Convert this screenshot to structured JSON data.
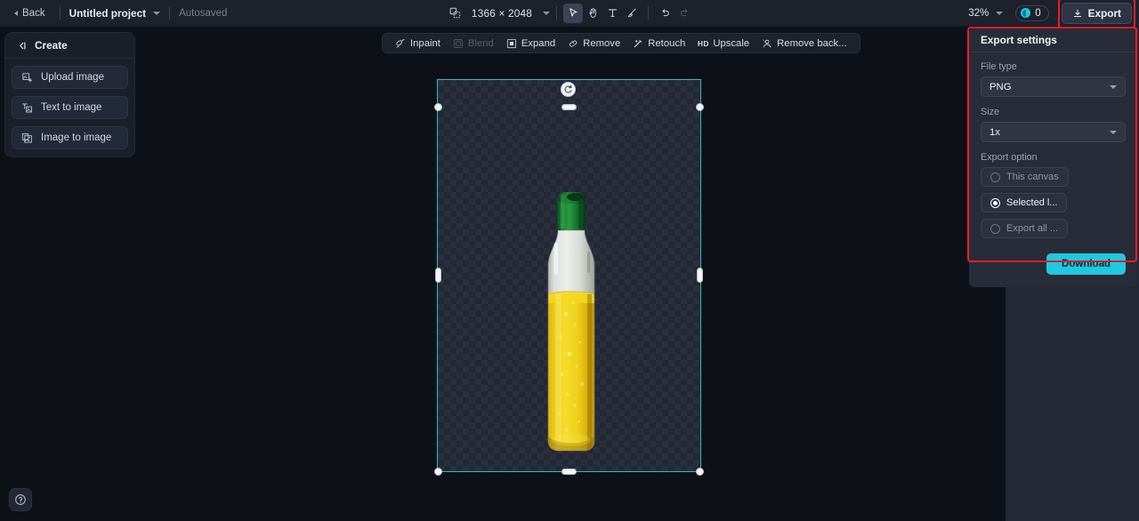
{
  "topbar": {
    "back_label": "Back",
    "project_name": "Untitled project",
    "autosaved_label": "Autosaved",
    "canvas_size_label": "1366 × 2048",
    "zoom_label": "32%",
    "credits_count": "0",
    "export_label": "Export",
    "tools": [
      {
        "name": "resize-canvas-icon",
        "label": "Resize canvas",
        "active": false
      },
      {
        "name": "select-tool-icon",
        "label": "Select",
        "active": true
      },
      {
        "name": "hand-tool-icon",
        "label": "Hand",
        "active": false
      },
      {
        "name": "text-tool-icon",
        "label": "Text",
        "active": false
      },
      {
        "name": "brush-tool-icon",
        "label": "Brush",
        "active": false
      },
      {
        "name": "undo-icon",
        "label": "Undo",
        "active": false
      },
      {
        "name": "redo-icon",
        "label": "Redo",
        "active": false
      }
    ]
  },
  "sidebar": {
    "header_label": "Create",
    "items": [
      {
        "label": "Upload image",
        "icon": "upload-image-icon"
      },
      {
        "label": "Text to image",
        "icon": "text-to-image-icon"
      },
      {
        "label": "Image to image",
        "icon": "image-to-image-icon"
      }
    ]
  },
  "canvas_tools": [
    {
      "label": "Inpaint",
      "icon": "inpaint-icon",
      "disabled": false
    },
    {
      "label": "Blend",
      "icon": "blend-icon",
      "disabled": true
    },
    {
      "label": "Expand",
      "icon": "expand-icon",
      "disabled": false
    },
    {
      "label": "Remove",
      "icon": "remove-icon",
      "disabled": false
    },
    {
      "label": "Retouch",
      "icon": "retouch-icon",
      "disabled": false
    },
    {
      "label": "Upscale",
      "icon": "upscale-hd-icon",
      "disabled": false
    },
    {
      "label": "Remove back...",
      "icon": "remove-background-icon",
      "disabled": false
    }
  ],
  "canvas": {
    "layer_name": "bottle-image-layer",
    "selection_color": "#2bbfc4"
  },
  "export_panel": {
    "title": "Export settings",
    "file_type_label": "File type",
    "file_type_value": "PNG",
    "size_label": "Size",
    "size_value": "1x",
    "export_option_label": "Export option",
    "options": [
      {
        "label": "This canvas",
        "selected": false
      },
      {
        "label": "Selected l...",
        "selected": true
      },
      {
        "label": "Export all ...",
        "selected": false
      }
    ],
    "download_label": "Download",
    "accent_color": "#20c9e0",
    "highlight_color": "#ee1c25"
  },
  "help": {
    "label": "Help"
  }
}
